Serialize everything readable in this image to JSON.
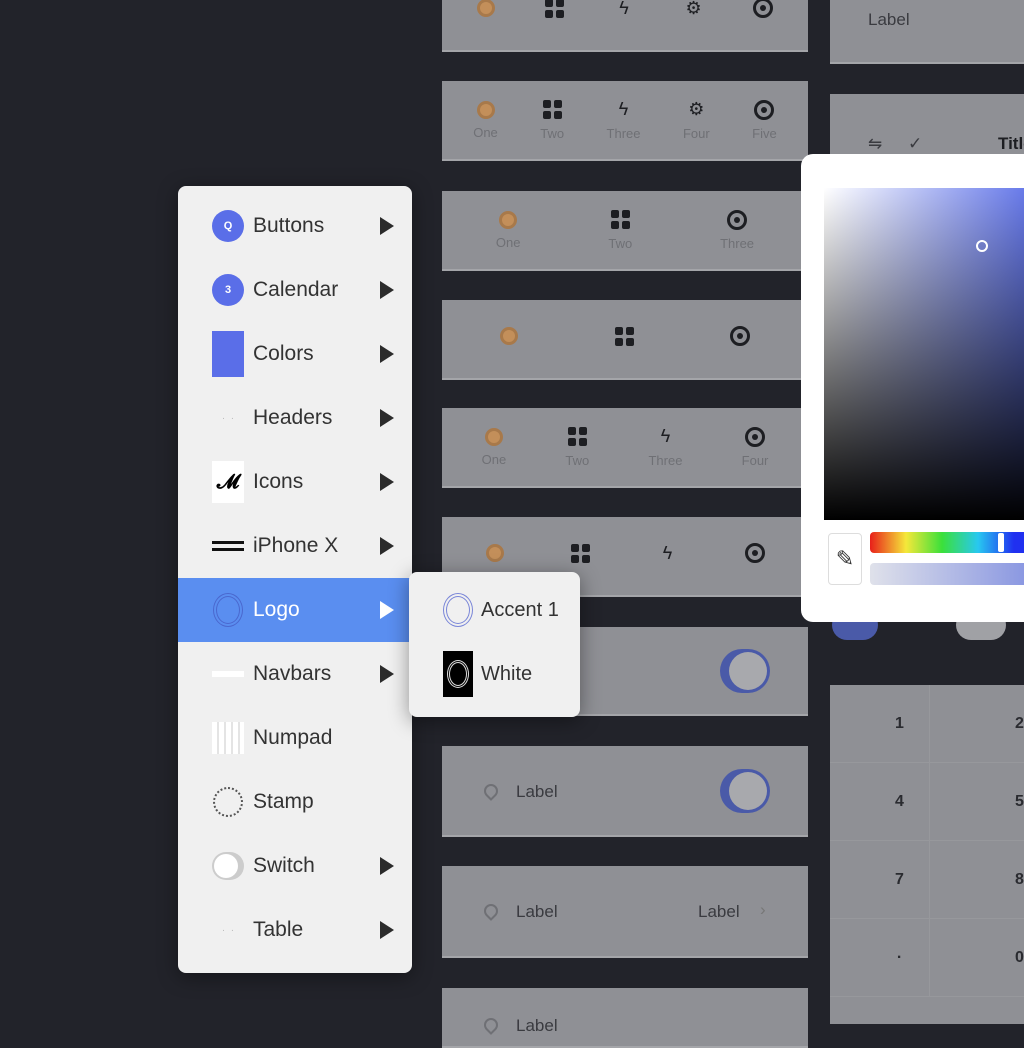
{
  "tabbars": [
    {
      "items": [
        "",
        "",
        "",
        "",
        ""
      ]
    },
    {
      "items": [
        "One",
        "Two",
        "Three",
        "Four",
        "Five"
      ]
    },
    {
      "items": [
        "One",
        "Two",
        "Three"
      ]
    },
    {
      "items": [
        "",
        "",
        ""
      ]
    },
    {
      "items": [
        "One",
        "Two",
        "Three",
        "Four"
      ]
    },
    {
      "items": [
        "",
        "",
        "",
        ""
      ]
    }
  ],
  "tab_icons": [
    "circle-icon",
    "grid-icon",
    "lightning-icon",
    "gear-icon",
    "target-icon"
  ],
  "rows": {
    "label": "Label",
    "detail": "Label"
  },
  "right_panel": {
    "label": "Label",
    "title": "Title"
  },
  "menu": {
    "items": [
      {
        "label": "Buttons",
        "icon": "button-icon",
        "submenu": true,
        "glyph": "Q"
      },
      {
        "label": "Calendar",
        "icon": "calendar-icon",
        "submenu": true,
        "glyph": "3"
      },
      {
        "label": "Colors",
        "icon": "color-swatch-icon",
        "submenu": true
      },
      {
        "label": "Headers",
        "icon": "header-icon",
        "submenu": true
      },
      {
        "label": "Icons",
        "icon": "waveform-icon",
        "submenu": true
      },
      {
        "label": "iPhone X",
        "icon": "iphone-bar-icon",
        "submenu": true
      },
      {
        "label": "Logo",
        "icon": "logo-icon",
        "submenu": true,
        "active": true
      },
      {
        "label": "Navbars",
        "icon": "navbar-icon",
        "submenu": true
      },
      {
        "label": "Numpad",
        "icon": "numpad-icon",
        "submenu": false
      },
      {
        "label": "Stamp",
        "icon": "stamp-icon",
        "submenu": false
      },
      {
        "label": "Switch",
        "icon": "switch-icon",
        "submenu": true
      },
      {
        "label": "Table",
        "icon": "table-icon",
        "submenu": true
      }
    ]
  },
  "submenu": {
    "items": [
      {
        "label": "Accent 1",
        "icon": "logo-accent-icon"
      },
      {
        "label": "White",
        "icon": "logo-white-icon"
      }
    ]
  },
  "numpad": {
    "keys": [
      "1",
      "2",
      "4",
      "5",
      "7",
      "8",
      "·",
      "0"
    ]
  },
  "colors": {
    "accent": "#5a6ee8",
    "highlight": "#5a8ef0",
    "background": "#22232a",
    "panel": "#8f9095"
  }
}
